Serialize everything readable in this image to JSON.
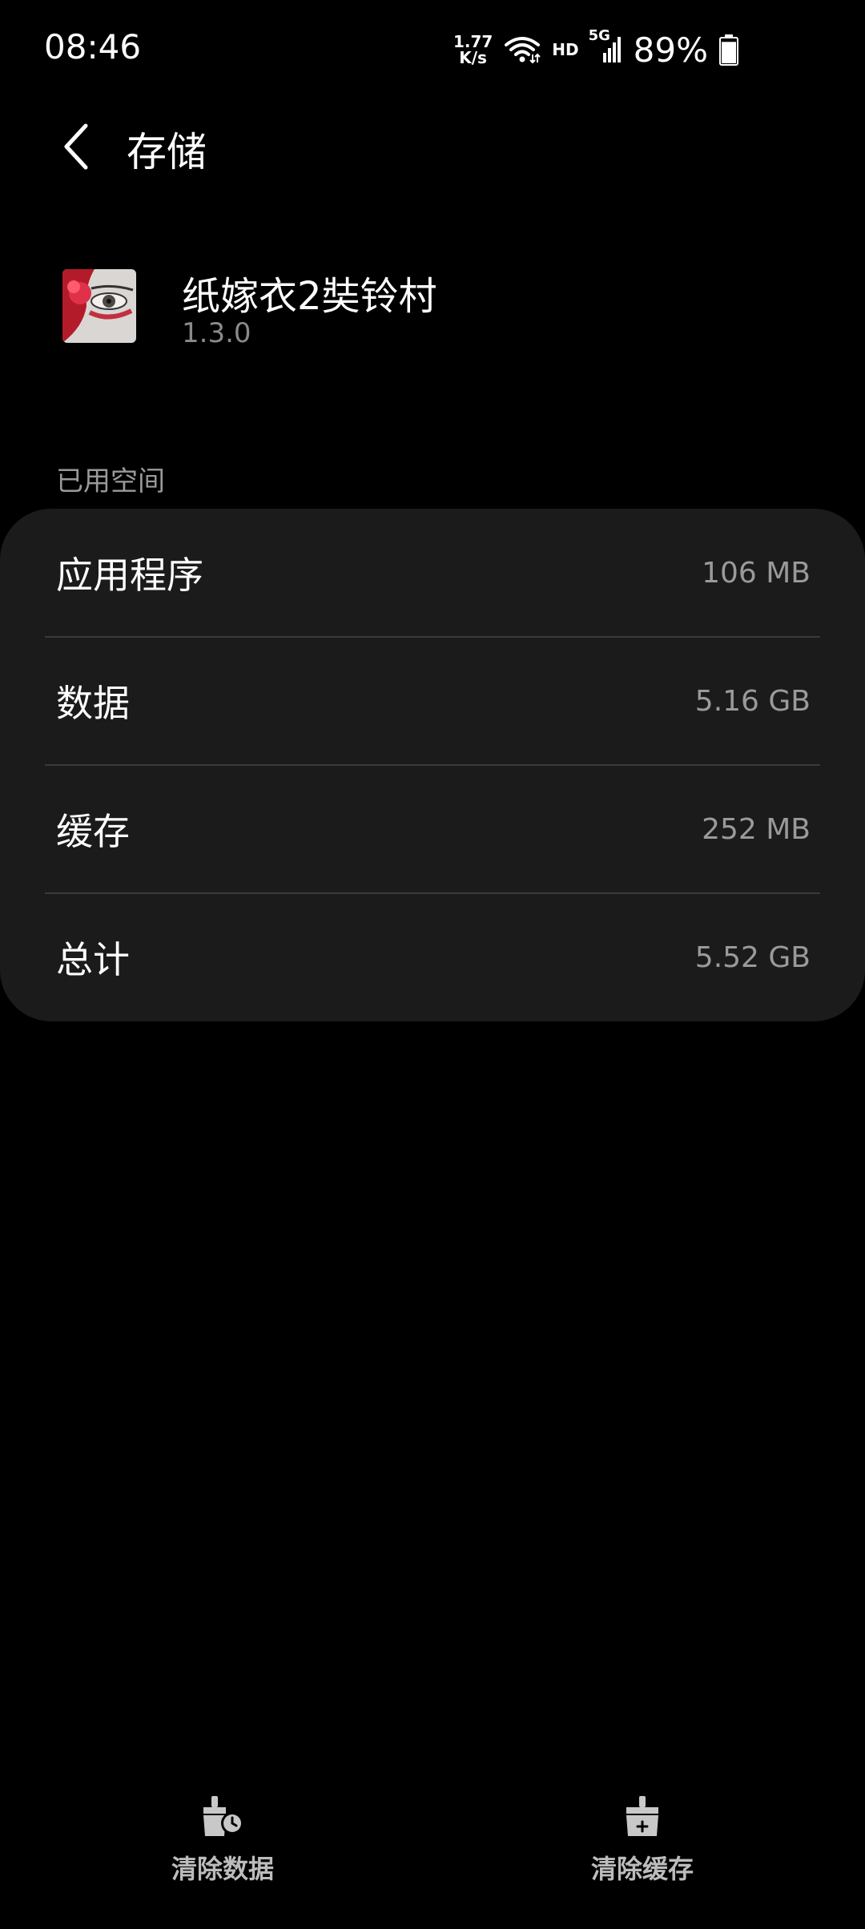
{
  "status_bar": {
    "time": "08:46",
    "net_speed_value": "1.77",
    "net_speed_unit": "K/s",
    "hd_label": "HD",
    "network_label": "5G",
    "battery_percent": "89%",
    "battery_level": 0.89
  },
  "app_bar": {
    "title": "存储"
  },
  "app": {
    "name": "纸嫁衣2奘铃村",
    "version": "1.3.0"
  },
  "section": {
    "label": "已用空间"
  },
  "storage": {
    "rows": [
      {
        "label": "应用程序",
        "value": "106 MB"
      },
      {
        "label": "数据",
        "value": "5.16 GB"
      },
      {
        "label": "缓存",
        "value": "252 MB"
      },
      {
        "label": "总计",
        "value": "5.52 GB"
      }
    ]
  },
  "actions": {
    "clear_data": "清除数据",
    "clear_cache": "清除缓存"
  },
  "icons": {
    "back": "chevron-left-icon",
    "wifi": "wifi-icon",
    "signal": "signal-icon",
    "battery": "battery-icon",
    "clear_data": "broom-clock-icon",
    "clear_cache": "broom-plus-icon"
  }
}
